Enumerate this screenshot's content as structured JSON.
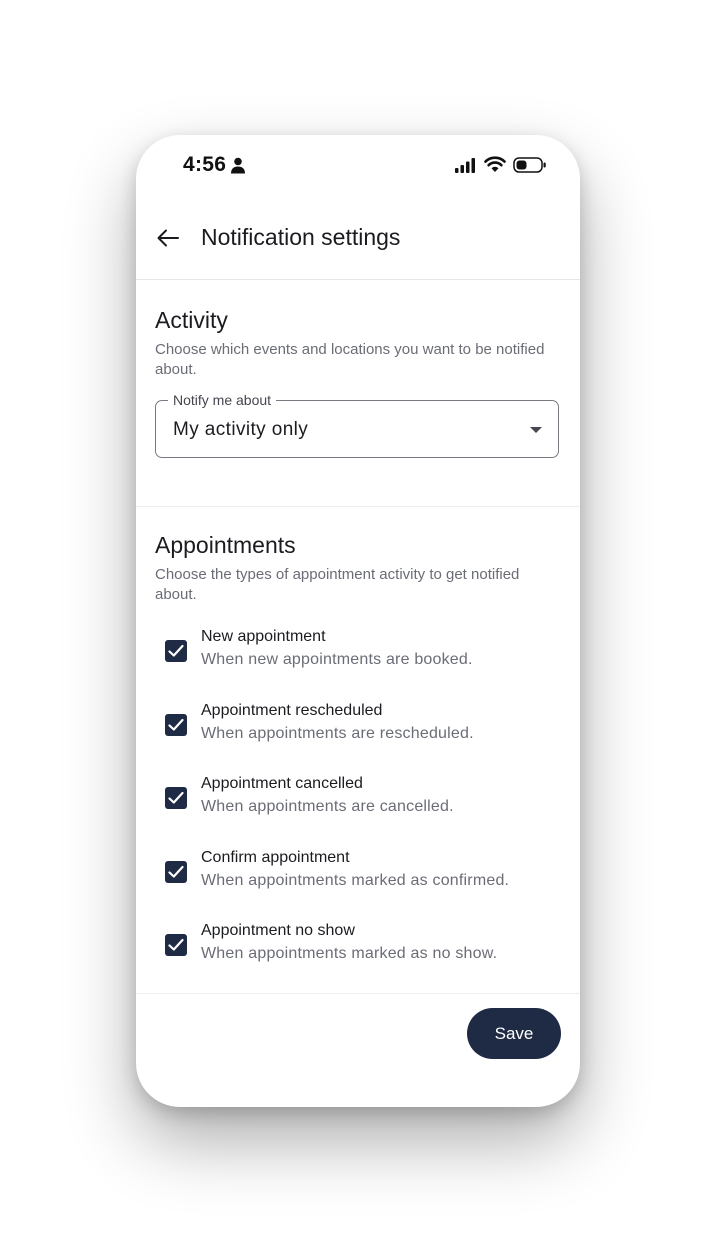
{
  "status_bar": {
    "time": "4:56"
  },
  "header": {
    "title": "Notification settings"
  },
  "activity": {
    "title": "Activity",
    "description": "Choose which events and locations you want to be notified about.",
    "select": {
      "label": "Notify me about",
      "value": "My activity only"
    }
  },
  "appointments": {
    "title": "Appointments",
    "description": "Choose the types of appointment activity to get notified about.",
    "items": [
      {
        "title": "New appointment",
        "description": "When new appointments are booked.",
        "checked": true
      },
      {
        "title": "Appointment rescheduled",
        "description": "When appointments are rescheduled.",
        "checked": true
      },
      {
        "title": "Appointment cancelled",
        "description": "When appointments are cancelled.",
        "checked": true
      },
      {
        "title": "Confirm appointment",
        "description": "When appointments marked as confirmed.",
        "checked": true
      },
      {
        "title": "Appointment no show",
        "description": "When appointments marked as no show.",
        "checked": true
      }
    ]
  },
  "footer": {
    "save_label": "Save"
  },
  "colors": {
    "primary": "#1f2a44",
    "text": "#1b1c20",
    "muted": "#6b6d76"
  }
}
